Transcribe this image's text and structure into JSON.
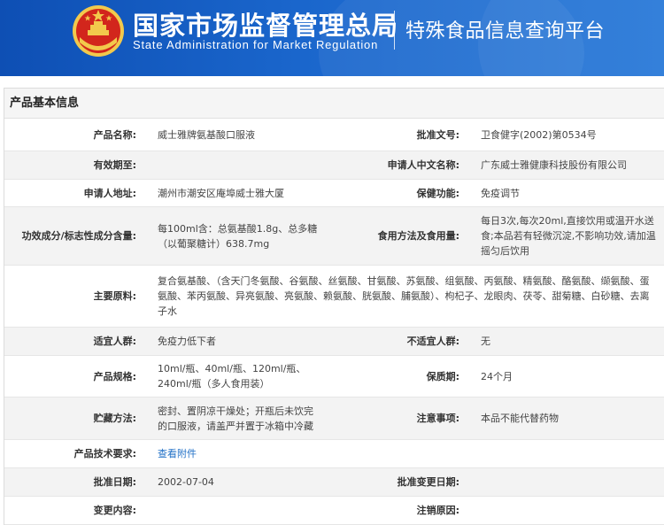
{
  "header": {
    "org_name_cn": "国家市场监督管理总局",
    "org_name_en": "State Administration for Market Regulation",
    "platform_name": "特殊食品信息查询平台",
    "colors": {
      "header_bg": "#1a66cc",
      "emblem_red": "#d2261c",
      "emblem_gold": "#f2c94c"
    }
  },
  "panel": {
    "title": "产品基本信息"
  },
  "fields": {
    "product_name": {
      "label": "产品名称:",
      "value": "威士雅牌氨基酸口服液"
    },
    "approval_no": {
      "label": "批准文号:",
      "value": "卫食健字(2002)第0534号"
    },
    "valid_until": {
      "label": "有效期至:",
      "value": ""
    },
    "applicant_cn": {
      "label": "申请人中文名称:",
      "value": "广东威士雅健康科技股份有限公司"
    },
    "applicant_address": {
      "label": "申请人地址:",
      "value": "潮州市潮安区庵埠威士雅大厦"
    },
    "health_function": {
      "label": "保健功能:",
      "value": "免疫调节"
    },
    "ingredients_content": {
      "label": "功效成分/标志性成分含量:",
      "value": "每100ml含：总氨基酸1.8g、总多糖（以葡聚糖计）638.7mg"
    },
    "usage": {
      "label": "食用方法及食用量:",
      "value": "每日3次,每次20ml,直接饮用或温开水送食;本品若有轻微沉淀,不影响功效,请加温摇匀后饮用"
    },
    "main_materials": {
      "label": "主要原料:",
      "value": "复合氨基酸、（含天门冬氨酸、谷氨酸、丝氨酸、甘氨酸、苏氨酸、组氨酸、丙氨酸、精氨酸、酪氨酸、缬氨酸、蛋氨酸、苯丙氨酸、异亮氨酸、亮氨酸、赖氨酸、胱氨酸、脯氨酸）、枸杞子、龙眼肉、茯苓、甜菊糖、白砂糖、去离子水"
    },
    "suitable_people": {
      "label": "适宜人群:",
      "value": "免疫力低下者"
    },
    "unsuitable_people": {
      "label": "不适宜人群:",
      "value": "无"
    },
    "spec": {
      "label": "产品规格:",
      "value": "10ml/瓶、40ml/瓶、120ml/瓶、240ml/瓶（多人食用装）"
    },
    "shelf_life": {
      "label": "保质期:",
      "value": "24个月"
    },
    "storage": {
      "label": "贮藏方法:",
      "value": "密封、置阴凉干燥处；开瓶后未饮完的口服液，请盖严并置于冰箱中冷藏"
    },
    "notes": {
      "label": "注意事项:",
      "value": "本品不能代替药物"
    },
    "tech_requirements": {
      "label": "产品技术要求:",
      "value": "查看附件"
    },
    "approval_date": {
      "label": "批准日期:",
      "value": "2002-07-04"
    },
    "approval_change_date": {
      "label": "批准变更日期:",
      "value": ""
    },
    "change_content": {
      "label": "变更内容:",
      "value": ""
    },
    "cancel_reason": {
      "label": "注销原因:",
      "value": ""
    }
  }
}
